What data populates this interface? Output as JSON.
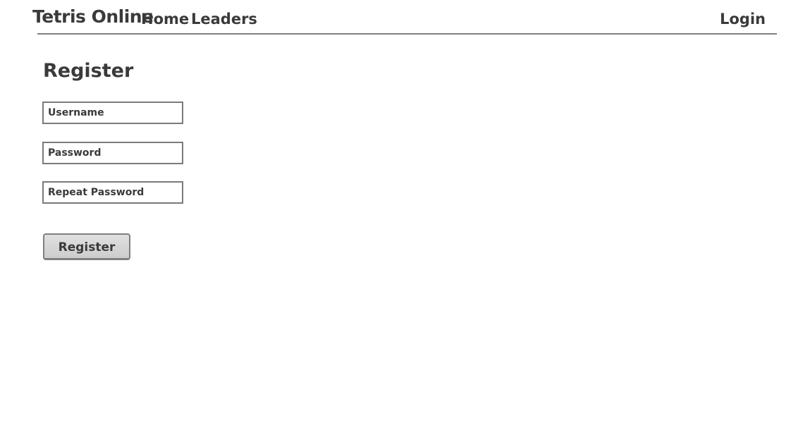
{
  "navbar": {
    "brand": "Tetris Online",
    "links": [
      {
        "label": "Home"
      },
      {
        "label": "Leaders"
      }
    ],
    "login_label": "Login"
  },
  "form": {
    "title": "Register",
    "fields": {
      "username_placeholder": "Username",
      "password_placeholder": "Password",
      "repeat_password_placeholder": "Repeat Password"
    },
    "submit_label": "Register"
  },
  "colors": {
    "text": "#3a3a3a",
    "border": "#7a7a7a",
    "button_bg": "#d6d6d6",
    "background": "#ffffff"
  }
}
